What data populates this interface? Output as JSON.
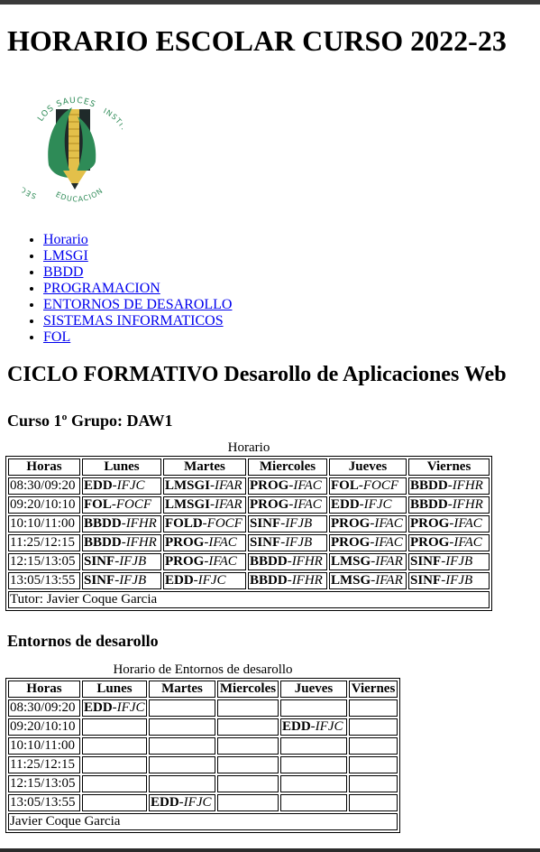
{
  "title": "HORARIO ESCOLAR CURSO 2022-23",
  "logo": {
    "top_text": "LOS SAUCES",
    "left_text": "SECUNDARIA",
    "right_text": "INSTITUTO DE",
    "bottom_text": "EDUCACION",
    "colors": {
      "green": "#2e8b57",
      "dark": "#1f2a2a",
      "yellow": "#e3c04a"
    }
  },
  "nav": {
    "items": [
      {
        "label": "Horario"
      },
      {
        "label": "LMSGI"
      },
      {
        "label": "BBDD"
      },
      {
        "label": "PROGRAMACION"
      },
      {
        "label": "ENTORNOS DE DESAROLLO"
      },
      {
        "label": "SISTEMAS INFORMATICOS"
      },
      {
        "label": "FOL"
      }
    ],
    "link_color": "#0000ee"
  },
  "section_title": "CICLO FORMATIVO Desarollo de Aplicaciones Web",
  "group_title": "Curso 1º Grupo: DAW1",
  "timetable": {
    "caption": "Horario",
    "headers": [
      "Horas",
      "Lunes",
      "Martes",
      "Miercoles",
      "Jueves",
      "Viernes"
    ],
    "rows": [
      {
        "hour": "08:30/09:20",
        "cells": [
          [
            "EDD",
            "IFJC"
          ],
          [
            "LMSGI",
            "IFAR"
          ],
          [
            "PROG",
            "IFAC"
          ],
          [
            "FOL",
            "FOCF"
          ],
          [
            "BBDD",
            "IFHR"
          ]
        ]
      },
      {
        "hour": "09:20/10:10",
        "cells": [
          [
            "FOL",
            "FOCF"
          ],
          [
            "LMSGI",
            "IFAR"
          ],
          [
            "PROG",
            "IFAC"
          ],
          [
            "EDD",
            "IFJC"
          ],
          [
            "BBDD",
            "IFHR"
          ]
        ]
      },
      {
        "hour": "10:10/11:00",
        "cells": [
          [
            "BBDD",
            "IFHR"
          ],
          [
            "FOLD",
            "FOCF"
          ],
          [
            "SINF",
            "IFJB"
          ],
          [
            "PROG",
            "IFAC"
          ],
          [
            "PROG",
            "IFAC"
          ]
        ]
      },
      {
        "hour": "11:25/12:15",
        "cells": [
          [
            "BBDD",
            "IFHR"
          ],
          [
            "PROG",
            "IFAC"
          ],
          [
            "SINF",
            "IFJB"
          ],
          [
            "PROG",
            "IFAC"
          ],
          [
            "PROG",
            "IFAC"
          ]
        ]
      },
      {
        "hour": "12:15/13:05",
        "cells": [
          [
            "SINF",
            "IFJB"
          ],
          [
            "PROG",
            "IFAC"
          ],
          [
            "BBDD",
            "IFHR"
          ],
          [
            "LMSG",
            "IFAR"
          ],
          [
            "SINF",
            "IFJB"
          ]
        ]
      },
      {
        "hour": "13:05/13:55",
        "cells": [
          [
            "SINF",
            "IFJB"
          ],
          [
            "EDD",
            "IFJC"
          ],
          [
            "BBDD",
            "IFHR"
          ],
          [
            "LMSG",
            "IFAR"
          ],
          [
            "SINF",
            "IFJB"
          ]
        ]
      }
    ],
    "footer": "Tutor: Javier Coque Garcia"
  },
  "entornos_title": "Entornos de desarollo",
  "entornos_table": {
    "caption": "Horario de Entornos de desarollo",
    "headers": [
      "Horas",
      "Lunes",
      "Martes",
      "Miercoles",
      "Jueves",
      "Viernes"
    ],
    "rows": [
      {
        "hour": "08:30/09:20",
        "cells": [
          [
            "EDD",
            "IFJC"
          ],
          null,
          null,
          null,
          null
        ]
      },
      {
        "hour": "09:20/10:10",
        "cells": [
          null,
          null,
          null,
          [
            "EDD",
            "IFJC"
          ],
          null
        ]
      },
      {
        "hour": "10:10/11:00",
        "cells": [
          null,
          null,
          null,
          null,
          null
        ]
      },
      {
        "hour": "11:25/12:15",
        "cells": [
          null,
          null,
          null,
          null,
          null
        ]
      },
      {
        "hour": "12:15/13:05",
        "cells": [
          null,
          null,
          null,
          null,
          null
        ]
      },
      {
        "hour": "13:05/13:55",
        "cells": [
          null,
          [
            "EDD",
            "IFJC"
          ],
          null,
          null,
          null
        ]
      }
    ],
    "footer": "Javier Coque Garcia"
  }
}
